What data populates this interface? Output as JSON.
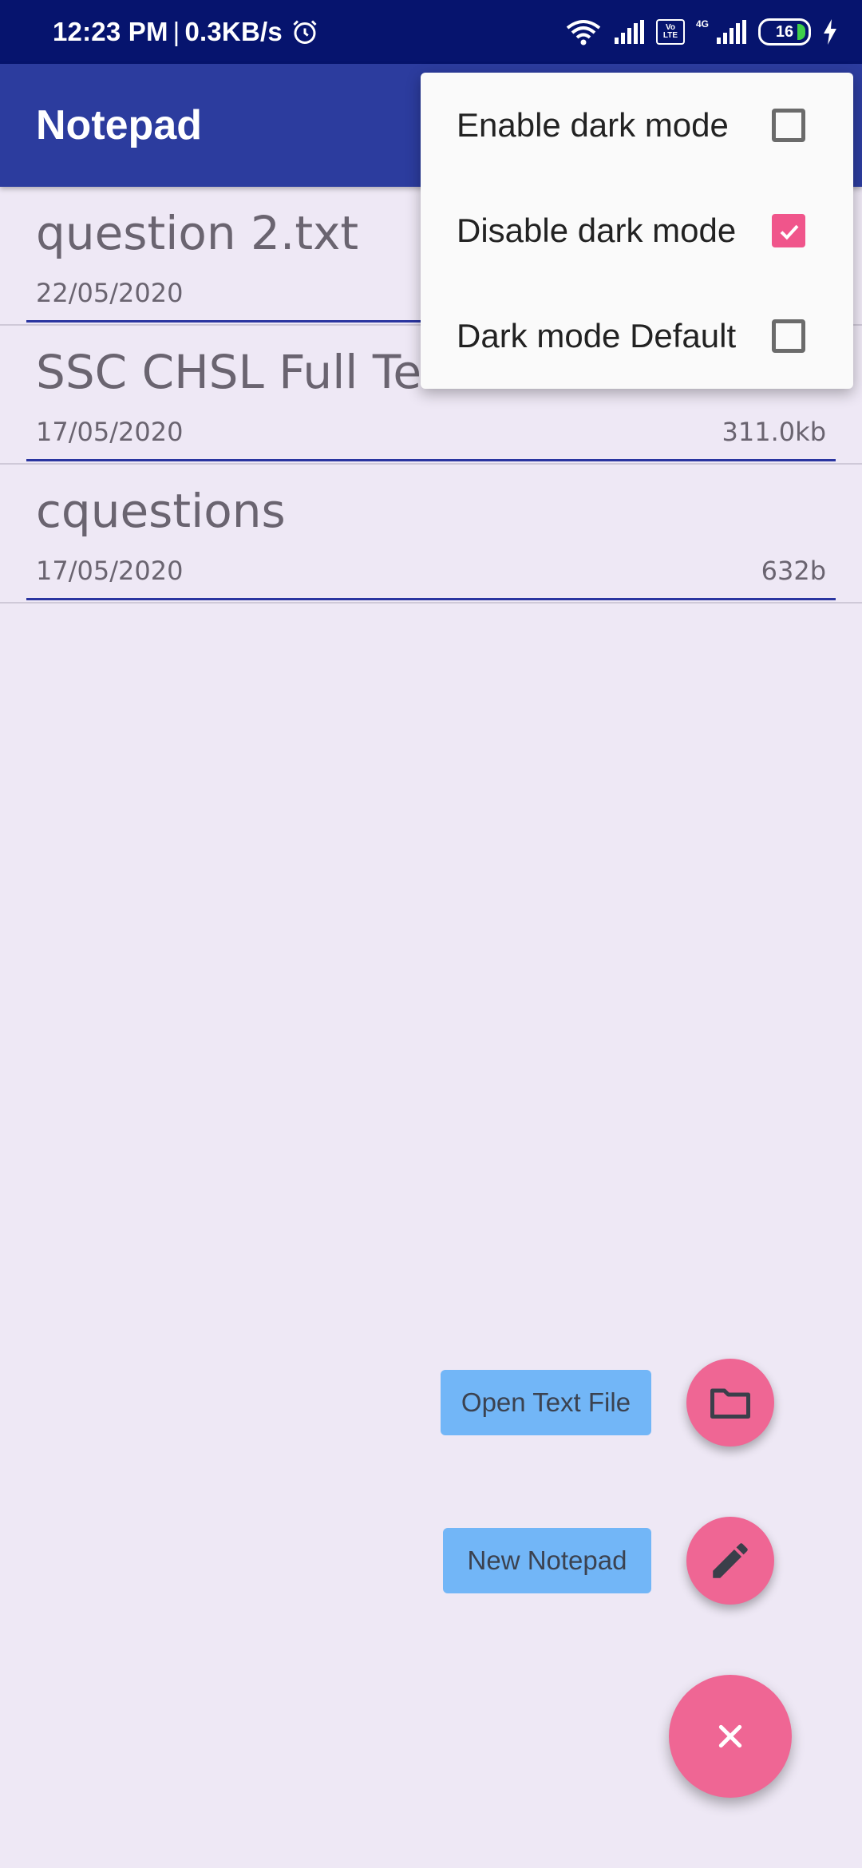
{
  "status_bar": {
    "time": "12:23 PM",
    "separator": "|",
    "speed": "0.3KB/s",
    "battery": "16",
    "volte_top": "Vo",
    "volte_bottom": "LTE",
    "network": "4G"
  },
  "app_bar": {
    "title": "Notepad"
  },
  "files": [
    {
      "name": "question 2.txt",
      "date": "22/05/2020",
      "size": ""
    },
    {
      "name": "SSC CHSL Full Tes",
      "date": "17/05/2020",
      "size": "311.0kb"
    },
    {
      "name": "cquestions",
      "date": "17/05/2020",
      "size": "632b"
    }
  ],
  "menu": {
    "items": [
      {
        "label": "Enable dark mode",
        "checked": false
      },
      {
        "label": "Disable dark mode",
        "checked": true
      },
      {
        "label": "Dark mode Default",
        "checked": false
      }
    ]
  },
  "fab": {
    "open_file_label": "Open Text File",
    "new_notepad_label": "New Notepad"
  },
  "icons": {
    "folder": "folder-icon",
    "pencil": "pencil-icon",
    "close": "close-icon"
  },
  "colors": {
    "status_bar": "#06146e",
    "app_bar": "#2c3c9e",
    "accent_pink": "#ef6694",
    "label_blue": "#72b6f7",
    "background": "#eee8f5"
  }
}
